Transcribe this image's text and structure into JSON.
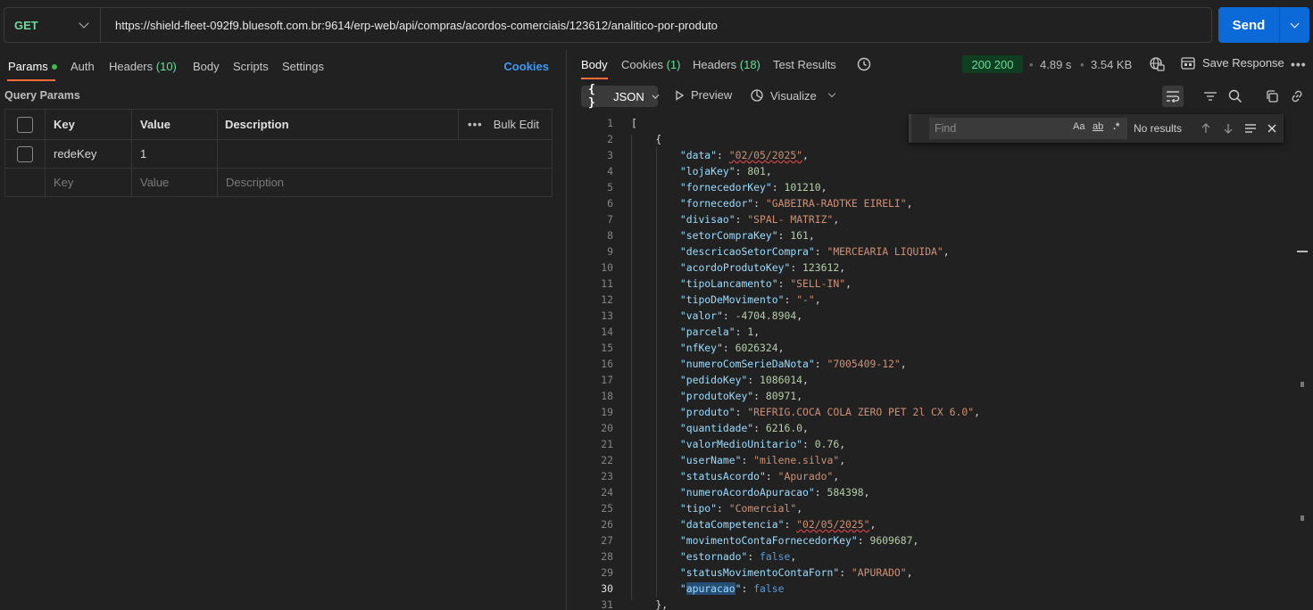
{
  "request": {
    "method": "GET",
    "url": "https://shield-fleet-092f9.bluesoft.com.br:9614/erp-web/api/compras/acordos-comerciais/123612/analitico-por-produto",
    "send_label": "Send"
  },
  "left_tabs": {
    "params": "Params",
    "auth": "Auth",
    "headers": "Headers",
    "headers_count": "(10)",
    "body": "Body",
    "scripts": "Scripts",
    "settings": "Settings",
    "cookies": "Cookies"
  },
  "query_params": {
    "title": "Query Params",
    "headers": {
      "key": "Key",
      "value": "Value",
      "description": "Description",
      "bulk_edit": "Bulk Edit"
    },
    "rows": [
      {
        "key": "redeKey",
        "value": "1",
        "description": ""
      }
    ],
    "placeholders": {
      "key": "Key",
      "value": "Value",
      "description": "Description"
    }
  },
  "response_tabs": {
    "body": "Body",
    "cookies": "Cookies",
    "cookies_count": "(1)",
    "headers": "Headers",
    "headers_count": "(18)",
    "test_results": "Test Results"
  },
  "response_meta": {
    "status": "200 200",
    "time": "4.89 s",
    "size": "3.54 KB",
    "save_response": "Save Response"
  },
  "response_toolbar": {
    "format": "JSON",
    "preview": "Preview",
    "visualize": "Visualize"
  },
  "find_widget": {
    "placeholder": "Find",
    "match_case": "Aa",
    "whole_word": "ab",
    "regex": ".*",
    "result": "No results"
  },
  "code_lines": [
    {
      "n": "1",
      "t": "["
    },
    {
      "n": "2",
      "t": "    {"
    },
    {
      "n": "3",
      "k": "data",
      "v": "\"02/05/2025\"",
      "vt": "s"
    },
    {
      "n": "4",
      "k": "lojaKey",
      "v": "801",
      "vt": "n"
    },
    {
      "n": "5",
      "k": "fornecedorKey",
      "v": "101210",
      "vt": "n"
    },
    {
      "n": "6",
      "k": "fornecedor",
      "v": "\"GABEIRA-RADTKE EIRELI\"",
      "vt": "s"
    },
    {
      "n": "7",
      "k": "divisao",
      "v": "\"SPAL- MATRIZ\"",
      "vt": "s"
    },
    {
      "n": "8",
      "k": "setorCompraKey",
      "v": "161",
      "vt": "n"
    },
    {
      "n": "9",
      "k": "descricaoSetorCompra",
      "v": "\"MERCEARIA LIQUIDA\"",
      "vt": "s"
    },
    {
      "n": "10",
      "k": "acordoProdutoKey",
      "v": "123612",
      "vt": "n"
    },
    {
      "n": "11",
      "k": "tipoLancamento",
      "v": "\"SELL-IN\"",
      "vt": "s"
    },
    {
      "n": "12",
      "k": "tipoDeMovimento",
      "v": "\"-\"",
      "vt": "s"
    },
    {
      "n": "13",
      "k": "valor",
      "v": "-4704.8904",
      "vt": "n"
    },
    {
      "n": "14",
      "k": "parcela",
      "v": "1",
      "vt": "n"
    },
    {
      "n": "15",
      "k": "nfKey",
      "v": "6026324",
      "vt": "n"
    },
    {
      "n": "16",
      "k": "numeroComSerieDaNota",
      "v": "\"7005409-12\"",
      "vt": "s"
    },
    {
      "n": "17",
      "k": "pedidoKey",
      "v": "1086014",
      "vt": "n"
    },
    {
      "n": "18",
      "k": "produtoKey",
      "v": "80971",
      "vt": "n"
    },
    {
      "n": "19",
      "k": "produto",
      "v": "\"REFRIG.COCA COLA ZERO PET 2l CX 6.0\"",
      "vt": "s"
    },
    {
      "n": "20",
      "k": "quantidade",
      "v": "6216.0",
      "vt": "n"
    },
    {
      "n": "21",
      "k": "valorMedioUnitario",
      "v": "0.76",
      "vt": "n"
    },
    {
      "n": "22",
      "k": "userName",
      "v": "\"milene.silva\"",
      "vt": "s"
    },
    {
      "n": "23",
      "k": "statusAcordo",
      "v": "\"Apurado\"",
      "vt": "s"
    },
    {
      "n": "24",
      "k": "numeroAcordoApuracao",
      "v": "584398",
      "vt": "n"
    },
    {
      "n": "25",
      "k": "tipo",
      "v": "\"Comercial\"",
      "vt": "s"
    },
    {
      "n": "26",
      "k": "dataCompetencia",
      "v": "\"02/05/2025\"",
      "vt": "s"
    },
    {
      "n": "27",
      "k": "movimentoContaFornecedorKey",
      "v": "9609687",
      "vt": "n"
    },
    {
      "n": "28",
      "k": "estornado",
      "v": "false",
      "vt": "b"
    },
    {
      "n": "29",
      "k": "statusMovimentoContaForn",
      "v": "\"APURADO\"",
      "vt": "s"
    },
    {
      "n": "30",
      "k": "apuracao",
      "v": "false",
      "vt": "b",
      "last": true
    },
    {
      "n": "31",
      "t": "    },"
    }
  ],
  "colors": {
    "accent_orange": "#ff6c37",
    "send_blue": "#0c6ad8",
    "method_green": "#6bdd9a",
    "status_bg": "#0f3f22"
  }
}
